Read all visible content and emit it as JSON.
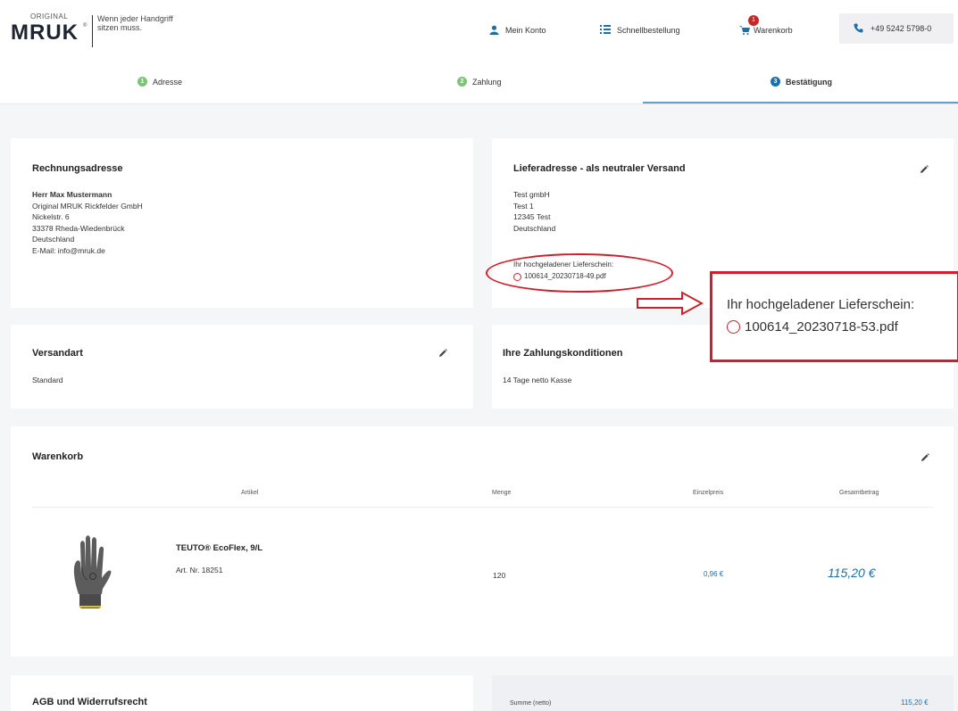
{
  "logo": {
    "original": "ORIGINAL",
    "brand": "MRUK",
    "registered": "®",
    "tagline": "Wenn jeder Handgriff sitzen muss."
  },
  "header": {
    "account": "Mein Konto",
    "quick_order": "Schnellbestellung",
    "cart": "Warenkorb",
    "cart_count": "1",
    "phone": "+49 5242 5798-0"
  },
  "steps": [
    {
      "num": "1",
      "label": "Adresse",
      "state": "done"
    },
    {
      "num": "2",
      "label": "Zahlung",
      "state": "done"
    },
    {
      "num": "3",
      "label": "Bestätigung",
      "state": "active"
    }
  ],
  "billing": {
    "title": "Rechnungsadresse",
    "name": "Herr Max Mustermann",
    "lines": [
      "Original MRUK Rickfelder GmbH",
      "Nickelstr. 6",
      "33378 Rheda-Wiedenbrück",
      "Deutschland",
      "E-Mail: info@mruk.de"
    ]
  },
  "delivery": {
    "title": "Lieferadresse - als neutraler Versand",
    "lines": [
      "Test gmbH",
      "Test 1",
      "12345 Test",
      "Deutschland"
    ],
    "upload_label": "Ihr hochgeladener Lieferschein:",
    "upload_file": "100614_20230718-49.pdf"
  },
  "callout": {
    "label": "Ihr hochgeladener Lieferschein:",
    "file": "100614_20230718-53.pdf"
  },
  "shipping": {
    "title": "Versandart",
    "value": "Standard"
  },
  "payment": {
    "title": "Ihre Zahlungskonditionen",
    "value": "14 Tage netto Kasse"
  },
  "cart": {
    "title": "Warenkorb",
    "columns": {
      "article": "Artikel",
      "quantity": "Menge",
      "unit_price": "Einzelpreis",
      "total": "Gesamtbetrag"
    },
    "items": [
      {
        "name": "TEUTO® EcoFlex, 9/L",
        "art_no": "Art. Nr. 18251",
        "quantity": "120",
        "unit_price": "0,96 €",
        "total": "115,20 €"
      }
    ]
  },
  "terms": {
    "title": "AGB und Widerrufsrecht"
  },
  "summary": {
    "label": "Summe (netto)",
    "value": "115,20 €"
  },
  "colors": {
    "accent": "#1e6fa8",
    "step_done": "#7cc576",
    "annotation": "#d21e2b",
    "brand": "#1c2530"
  }
}
